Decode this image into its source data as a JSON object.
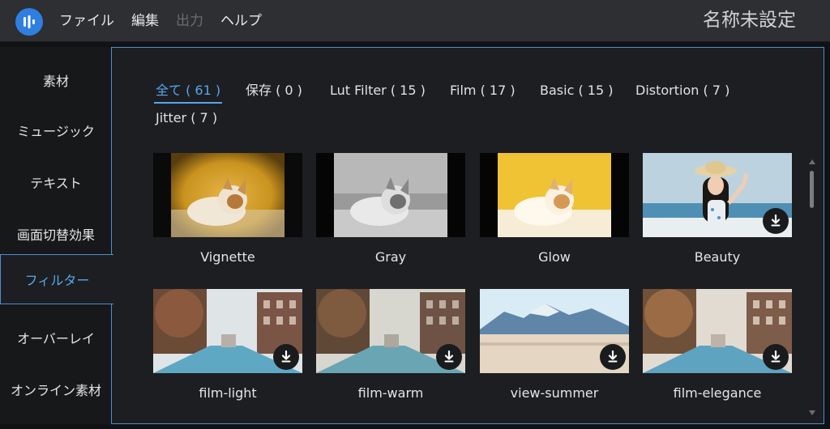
{
  "app": {
    "logo": "app-logo-icon",
    "menu": [
      "ファイル",
      "編集",
      "出力",
      "ヘルプ"
    ],
    "menu_disabled_index": 2,
    "document_title": "名称未設定"
  },
  "sidebar": {
    "items": [
      "素材",
      "ミュージック",
      "テキスト",
      "画面切替効果",
      "フィルター",
      "オーバーレイ",
      "オンライン素材"
    ],
    "active_index": 4
  },
  "filter_tabs": [
    {
      "label": "全て ( 61 )",
      "active": true
    },
    {
      "label": "保存 ( 0 )"
    },
    {
      "label": "Lut Filter ( 15 )"
    },
    {
      "label": "Film ( 17 )"
    },
    {
      "label": "Basic ( 15 )"
    },
    {
      "label": "Distortion ( 7 )"
    },
    {
      "label": "Jitter ( 7 )"
    }
  ],
  "filters": [
    {
      "name": "Vignette",
      "downloadable": false,
      "icon": "download-icon"
    },
    {
      "name": "Gray",
      "downloadable": false,
      "icon": "download-icon"
    },
    {
      "name": "Glow",
      "downloadable": false,
      "icon": "download-icon"
    },
    {
      "name": "Beauty",
      "downloadable": true,
      "icon": "download-icon"
    },
    {
      "name": "film-light",
      "downloadable": true,
      "icon": "download-icon"
    },
    {
      "name": "film-warm",
      "downloadable": true,
      "icon": "download-icon"
    },
    {
      "name": "view-summer",
      "downloadable": true,
      "icon": "download-icon"
    },
    {
      "name": "film-elegance",
      "downloadable": true,
      "icon": "download-icon"
    }
  ],
  "colors": {
    "accent": "#56a6ee",
    "panel_border": "#4b8fd1",
    "topbar": "#2e2f32",
    "panel_bg": "#1d1e21"
  }
}
